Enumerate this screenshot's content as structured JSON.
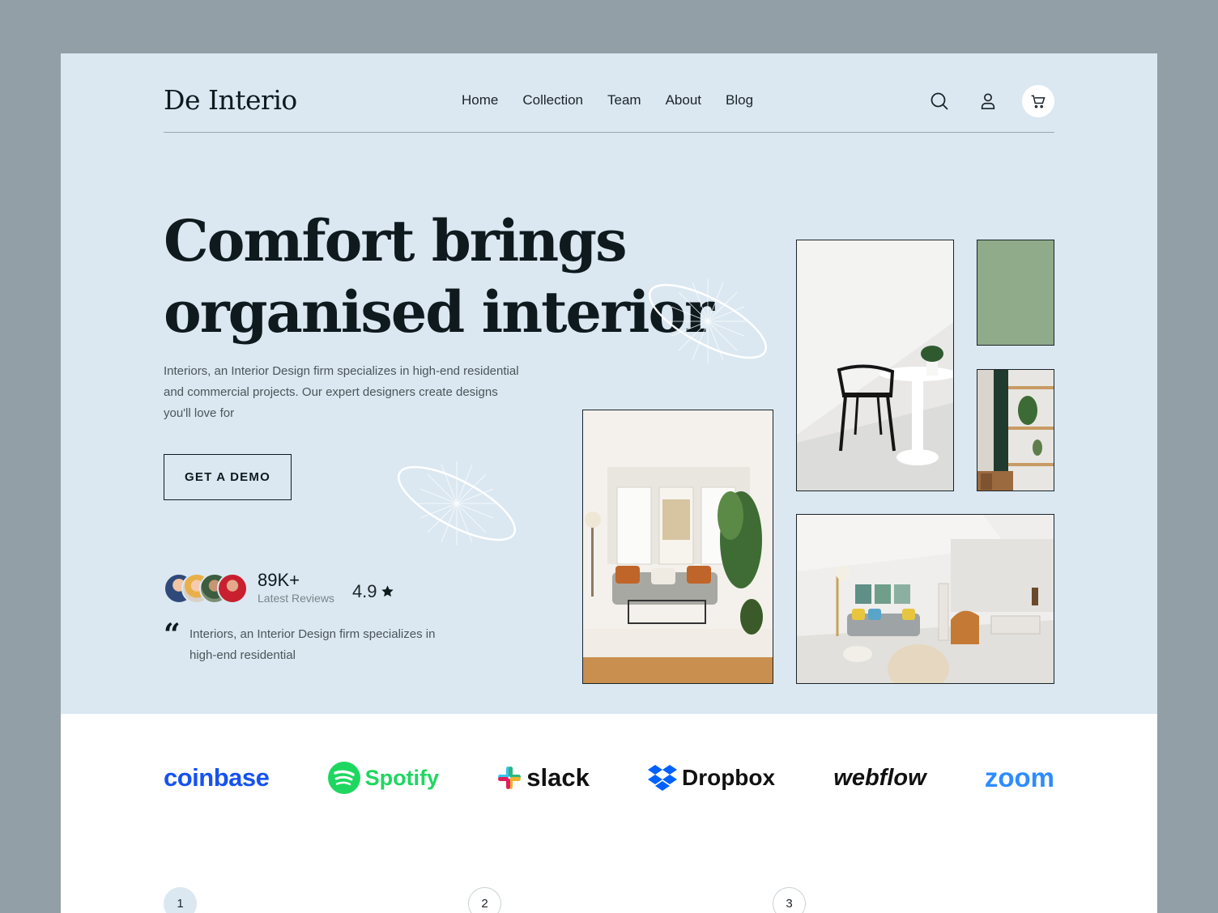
{
  "header": {
    "logo": "De Interio",
    "nav": [
      "Home",
      "Collection",
      "Team",
      "About",
      "Blog"
    ]
  },
  "hero": {
    "headline_line1": "Comfort brings",
    "headline_line2": "organised interior",
    "subtitle": "Interiors, an Interior Design firm specializes in high-end residential and commercial projects. Our expert designers create designs you'll love for",
    "cta": "GET A DEMO",
    "reviews_count": "89K+",
    "reviews_label": "Latest Reviews",
    "rating": "4.9",
    "quote": "Interiors, an Interior Design firm specializes in high-end residential"
  },
  "brands": [
    "coinbase",
    "Spotify",
    "slack",
    "Dropbox",
    "webflow",
    "zoom"
  ],
  "steps": [
    "1",
    "2",
    "3"
  ],
  "colors": {
    "hero_bg": "#dbe8f1",
    "accent_green": "#8fab89",
    "coinbase": "#1652f0",
    "spotify": "#1ed760",
    "dropbox": "#0061fe",
    "zoom": "#2d8cff"
  }
}
